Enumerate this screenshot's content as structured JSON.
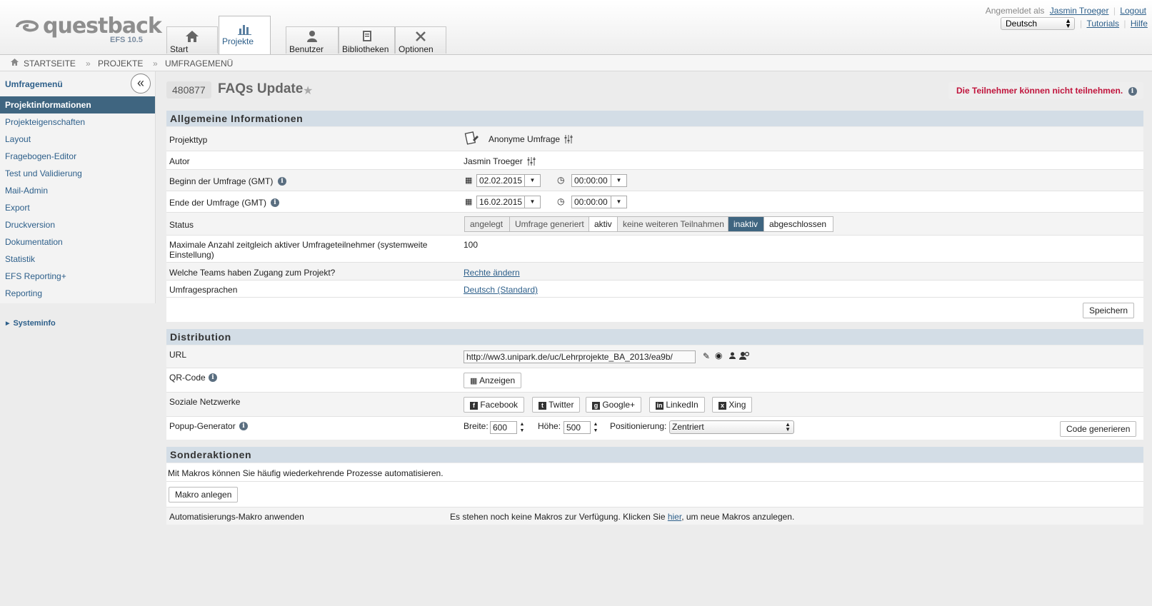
{
  "header": {
    "logo_text": "questback",
    "version": "EFS 10.5",
    "nav_tabs": [
      {
        "label": "Start",
        "icon": "home-icon"
      },
      {
        "label": "Projekte",
        "icon": "bar-chart-icon"
      },
      {
        "label": "Benutzer",
        "icon": "user-icon"
      },
      {
        "label": "Bibliotheken",
        "icon": "library-icon"
      },
      {
        "label": "Optionen",
        "icon": "tools-icon"
      }
    ],
    "logged_in_label": "Angemeldet als",
    "user_name": "Jasmin Troeger",
    "logout": "Logout",
    "language": "Deutsch",
    "tutorials": "Tutorials",
    "help": "Hilfe"
  },
  "breadcrumb": [
    "STARTSEITE",
    "PROJEKTE",
    "UMFRAGEMENÜ"
  ],
  "sidebar": {
    "heading": "Umfragemenü",
    "items": [
      "Projektinformationen",
      "Projekteigenschaften",
      "Layout",
      "Fragebogen-Editor",
      "Test und Validierung",
      "Mail-Admin",
      "Export",
      "Druckversion",
      "Dokumentation",
      "Statistik",
      "EFS Reporting+",
      "Reporting"
    ],
    "active_index": 0,
    "systeminfo": "Systeminfo"
  },
  "project": {
    "id": "480877",
    "title": "FAQs Update",
    "warning": "Die Teilnehmer können nicht teilnehmen."
  },
  "general": {
    "heading": "Allgemeine Informationen",
    "project_type_label": "Projekttyp",
    "project_type_value": "Anonyme Umfrage",
    "author_label": "Autor",
    "author_value": "Jasmin Troeger",
    "start_label": "Beginn der Umfrage (GMT)",
    "start_date": "02.02.2015",
    "start_time": "00:00:00",
    "end_label": "Ende der Umfrage (GMT)",
    "end_date": "16.02.2015",
    "end_time": "00:00:00",
    "status_label": "Status",
    "status_options": [
      "angelegt",
      "Umfrage generiert",
      "aktiv",
      "keine weiteren Teilnahmen",
      "inaktiv",
      "abgeschlossen"
    ],
    "status_selected": "inaktiv",
    "max_label": "Maximale Anzahl zeitgleich aktiver Umfrageteilnehmer (systemweite Einstellung)",
    "max_value": "100",
    "teams_label": "Welche Teams haben Zugang zum Projekt?",
    "teams_link": "Rechte ändern",
    "languages_label": "Umfragesprachen",
    "languages_link": "Deutsch (Standard)",
    "save_button": "Speichern"
  },
  "distribution": {
    "heading": "Distribution",
    "url_label": "URL",
    "url_value": "http://ww3.unipark.de/uc/Lehrprojekte_BA_2013/ea9b/",
    "qr_label": "QR-Code",
    "qr_button": "Anzeigen",
    "social_label": "Soziale Netzwerke",
    "social_buttons": [
      "Facebook",
      "Twitter",
      "Google+",
      "LinkedIn",
      "Xing"
    ],
    "popup_label": "Popup-Generator",
    "width_label": "Breite:",
    "width_value": "600",
    "height_label": "Höhe:",
    "height_value": "500",
    "position_label": "Positionierung:",
    "position_value": "Zentriert",
    "generate_button": "Code generieren"
  },
  "special": {
    "heading": "Sonderaktionen",
    "description": "Mit Makros können Sie häufig wiederkehrende Prozesse automatisieren.",
    "create_button": "Makro anlegen",
    "apply_label": "Automatisierungs-Makro anwenden",
    "no_macros_before": "Es stehen noch keine Makros zur Verfügung. Klicken Sie ",
    "no_macros_link": "hier",
    "no_macros_after": ", um neue Makros anzulegen."
  }
}
